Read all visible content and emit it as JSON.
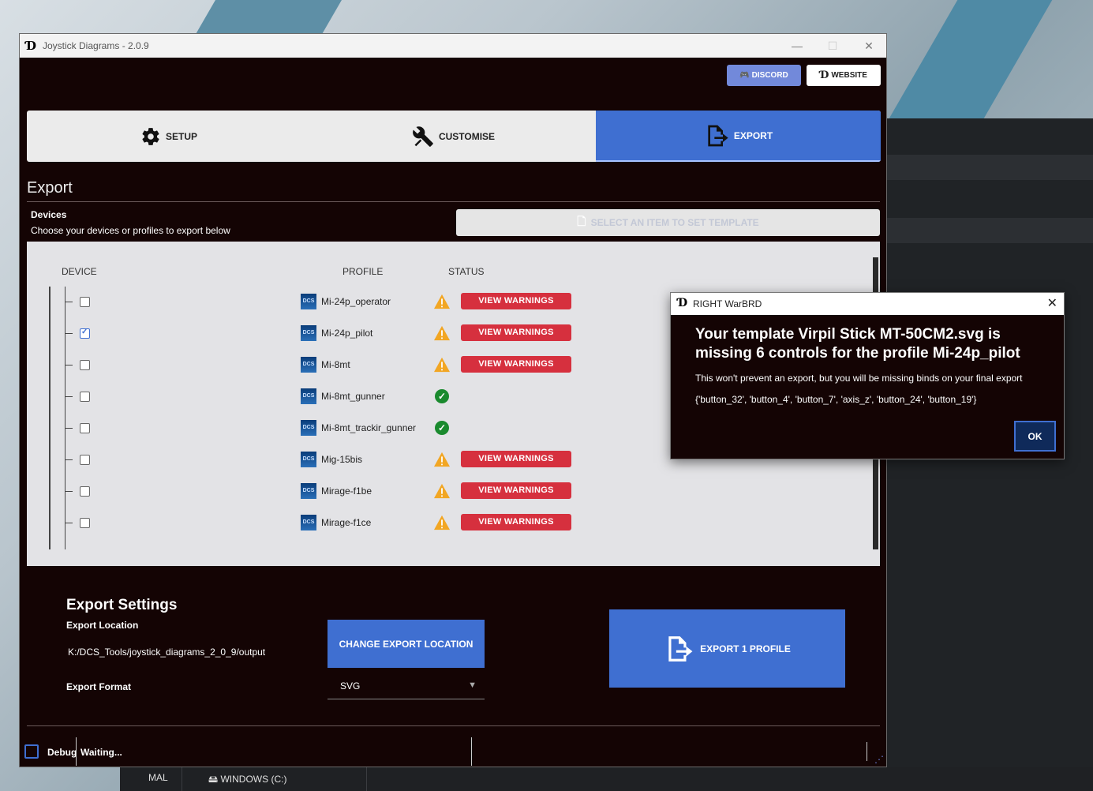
{
  "window": {
    "title": "Joystick Diagrams - 2.0.9"
  },
  "header": {
    "discord_label": "DISCORD",
    "website_label": "WEBSITE"
  },
  "tabs": [
    {
      "label": "SETUP",
      "icon": "gear-icon"
    },
    {
      "label": "CUSTOMISE",
      "icon": "tools-icon"
    },
    {
      "label": "EXPORT",
      "icon": "export-icon",
      "active": true
    }
  ],
  "export": {
    "heading": "Export",
    "devices_heading": "Devices",
    "devices_sub": "Choose your devices or profiles to export below",
    "template_btn": "SELECT AN ITEM TO SET TEMPLATE",
    "columns": {
      "device": "DEVICE",
      "profile": "PROFILE",
      "status": "STATUS"
    },
    "dcs_badge": "DCS",
    "view_warnings_label": "VIEW WARNINGS",
    "profiles": [
      {
        "name": "Mi-24p_operator",
        "checked": false,
        "status": "warning"
      },
      {
        "name": "Mi-24p_pilot",
        "checked": true,
        "status": "warning"
      },
      {
        "name": "Mi-8mt",
        "checked": false,
        "status": "warning"
      },
      {
        "name": "Mi-8mt_gunner",
        "checked": false,
        "status": "ok"
      },
      {
        "name": "Mi-8mt_trackir_gunner",
        "checked": false,
        "status": "ok"
      },
      {
        "name": "Mig-15bis",
        "checked": false,
        "status": "warning"
      },
      {
        "name": "Mirage-f1be",
        "checked": false,
        "status": "warning"
      },
      {
        "name": "Mirage-f1ce",
        "checked": false,
        "status": "warning"
      }
    ]
  },
  "settings": {
    "heading": "Export Settings",
    "location_label": "Export Location",
    "location_path": "K:/DCS_Tools/joystick_diagrams_2_0_9/output",
    "change_btn": "CHANGE EXPORT LOCATION",
    "format_label": "Export Format",
    "format_value": "SVG",
    "export_btn": "EXPORT 1 PROFILE"
  },
  "footer": {
    "debug_label": "Debug",
    "status": "Waiting..."
  },
  "dialog": {
    "title": "RIGHT WarBRD",
    "message": "Your template Virpil Stick MT-50CM2.svg is missing 6 controls for the profile Mi-24p_pilot",
    "sub": "This won't prevent an export, but you will be missing binds on your final export",
    "missing": "{'button_32', 'button_4', 'button_7', 'axis_z', 'button_24', 'button_19'}",
    "ok_label": "OK"
  },
  "taskbar": {
    "item1": "MAL",
    "item2": "WINDOWS (C:)"
  },
  "colors": {
    "accent": "#3f6fd1",
    "warning_btn": "#d6303e",
    "discord": "#7289da",
    "bg": "#140404"
  }
}
